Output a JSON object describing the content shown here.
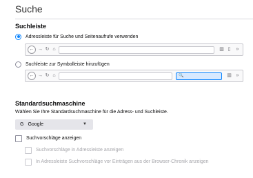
{
  "page": {
    "title": "Suche"
  },
  "search_bar": {
    "heading": "Suchleiste",
    "option_address": "Adressleiste für Suche und Seitenaufrufe verwenden",
    "option_toolbar": "Suchleiste zur Symbolleiste hinzufügen",
    "selected": "option_address"
  },
  "default_engine": {
    "heading": "Standardsuchmaschine",
    "description": "Wählen Sie Ihre Standardsuchmaschine für die Adress- und Suchleiste.",
    "selected_engine": "Google",
    "engine_icon": "G"
  },
  "suggestions": {
    "show": "Suchvorschläge anzeigen",
    "in_address_bar": "Suchvorschläge in Adressleiste anzeigen",
    "before_history": "In Adressleiste Suchvorschläge vor Einträgen aus der Browser-Chronik anzeigen"
  },
  "colors": {
    "accent": "#0a84ff",
    "border": "#d7d7db",
    "disabled_text": "#a6a6ab"
  }
}
